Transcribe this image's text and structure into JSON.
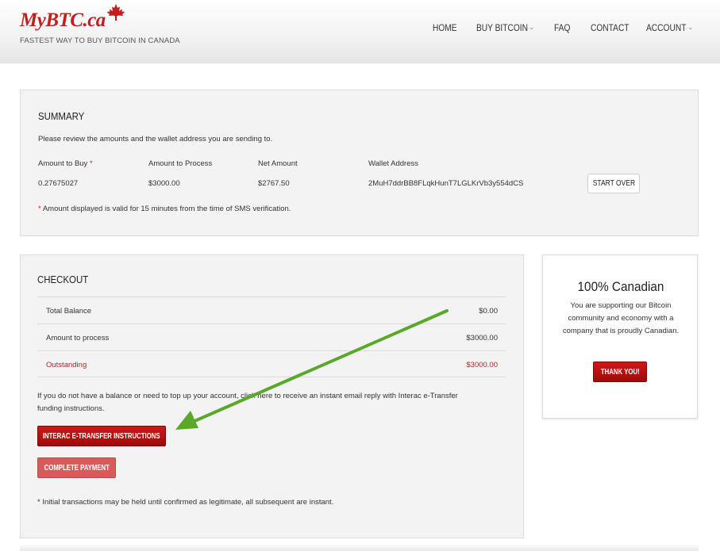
{
  "brand": {
    "logo_text": "MyBTC.ca",
    "tagline": "FASTEST WAY TO BUY BITCOIN IN CANADA",
    "accent_color": "#c41e1e"
  },
  "nav": {
    "home": "HOME",
    "buy_bitcoin": "BUY BITCOIN",
    "faq": "FAQ",
    "contact": "CONTACT",
    "account": "ACCOUNT",
    "caret_icon": "chevron-down-icon"
  },
  "summary": {
    "title": "SUMMARY",
    "intro": "Please review the amounts and the wallet address you are sending to.",
    "headers": {
      "amount_to_buy": "Amount to Buy",
      "amount_to_process": "Amount to Process",
      "net_amount": "Net Amount",
      "wallet_address": "Wallet Address"
    },
    "required_mark": "*",
    "values": {
      "amount_to_buy": "0.27675027",
      "amount_to_process": "$3000.00",
      "net_amount": "$2767.50",
      "wallet_address": "2MuH7ddrBB8FLqkHunT7LGLKrVb3y554dCS"
    },
    "start_over": "START OVER",
    "note": "Amount displayed is valid for 15 minutes from the time of SMS verification."
  },
  "checkout": {
    "title": "CHECKOUT",
    "rows": [
      {
        "label": "Total Balance",
        "value": "$0.00"
      },
      {
        "label": "Amount to process",
        "value": "$3000.00"
      },
      {
        "label": "Outstanding",
        "value": "$3000.00"
      }
    ],
    "instructions_line1": "If you do not have a balance or need to top up your account, click here to receive an instant email reply with Interac e-Transfer",
    "instructions_line2": "funding instructions.",
    "interac_button": "INTERAC E-TRANSFER INSTRUCTIONS",
    "complete_button": "COMPLETE PAYMENT",
    "footnote": "* Initial transactions may be held until confirmed as legitimate, all subsequent are instant."
  },
  "sidebar_card": {
    "title": "100% Canadian",
    "body": "You are supporting our Bitcoin community and economy with a company that is proudly Canadian.",
    "button": "THANK YOU!"
  },
  "annotation": {
    "arrow_color": "#5aa82a",
    "arrow_icon": "annotation-arrow-icon"
  }
}
